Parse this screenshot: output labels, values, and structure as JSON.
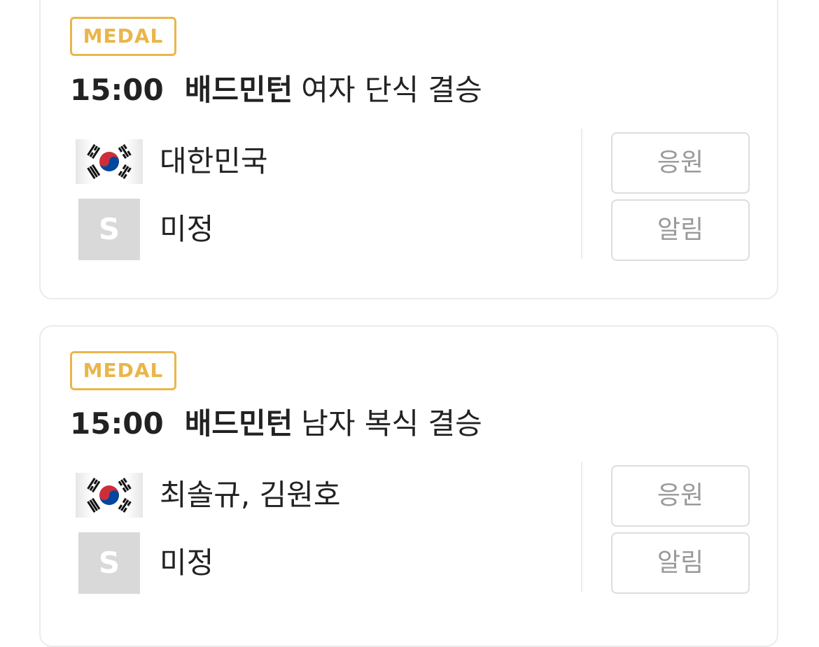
{
  "colors": {
    "medal_badge": "#eab64a",
    "button_text": "#999999",
    "button_border": "#dddddd",
    "card_border": "#ebebeb",
    "placeholder_bg": "#d9d9d9"
  },
  "matches": [
    {
      "badge": "MEDAL",
      "time": "15:00",
      "sport": "배드민턴",
      "event": "여자 단식 결승",
      "teams": [
        {
          "flag": "korea-flag-icon",
          "name": "대한민국"
        },
        {
          "flag": "placeholder-s-icon",
          "placeholder_letter": "S",
          "name": "미정"
        }
      ],
      "cheer_label": "응원",
      "alarm_label": "알림"
    },
    {
      "badge": "MEDAL",
      "time": "15:00",
      "sport": "배드민턴",
      "event": "남자 복식 결승",
      "teams": [
        {
          "flag": "korea-flag-icon",
          "name": "최솔규, 김원호"
        },
        {
          "flag": "placeholder-s-icon",
          "placeholder_letter": "S",
          "name": "미정"
        }
      ],
      "cheer_label": "응원",
      "alarm_label": "알림"
    }
  ]
}
